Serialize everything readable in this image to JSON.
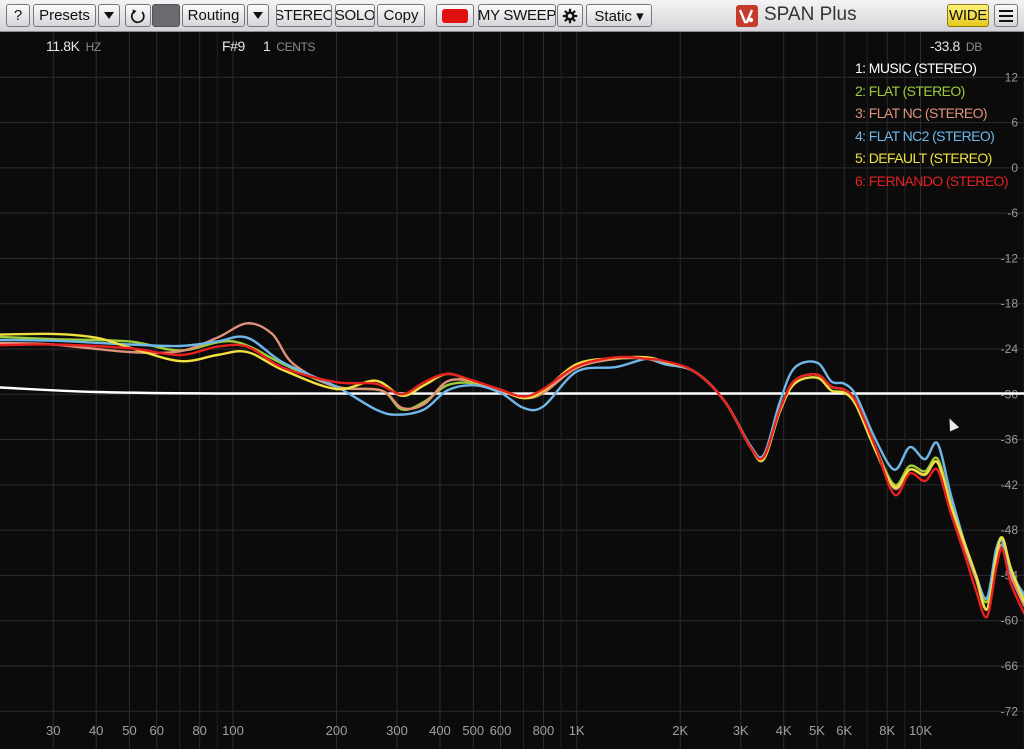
{
  "toolbar": {
    "help_label": "?",
    "presets_label": "Presets",
    "routing_label": "Routing",
    "stereo_label": "STEREO",
    "solo_label": "SOLO",
    "copy_label": "Copy",
    "sweep_label": "MY SWEEP",
    "mode_label": "Static ▾",
    "wide_label": "WIDE",
    "app_title": "SPAN Plus",
    "record_color": "#e01010"
  },
  "readout": {
    "freq_value": "11.8K",
    "freq_unit": "HZ",
    "note": "F#9",
    "cents_value": "1",
    "cents_unit": "CENTS",
    "level_value": "-33.8",
    "level_unit": "DB"
  },
  "chart_data": {
    "type": "line",
    "title": "",
    "xlabel": "",
    "ylabel": "",
    "x_scale": "log",
    "xlim": [
      21,
      20000
    ],
    "ylim": [
      -77,
      18
    ],
    "x_ticks": [
      {
        "value": 30,
        "label": "30"
      },
      {
        "value": 40,
        "label": "40"
      },
      {
        "value": 50,
        "label": "50"
      },
      {
        "value": 60,
        "label": "60"
      },
      {
        "value": 80,
        "label": "80"
      },
      {
        "value": 100,
        "label": "100"
      },
      {
        "value": 200,
        "label": "200"
      },
      {
        "value": 300,
        "label": "300"
      },
      {
        "value": 400,
        "label": "400"
      },
      {
        "value": 500,
        "label": "500"
      },
      {
        "value": 600,
        "label": "600"
      },
      {
        "value": 800,
        "label": "800"
      },
      {
        "value": 1000,
        "label": "1K"
      },
      {
        "value": 2000,
        "label": "2K"
      },
      {
        "value": 3000,
        "label": "3K"
      },
      {
        "value": 4000,
        "label": "4K"
      },
      {
        "value": 5000,
        "label": "5K"
      },
      {
        "value": 6000,
        "label": "6K"
      },
      {
        "value": 8000,
        "label": "8K"
      },
      {
        "value": 10000,
        "label": "10K"
      }
    ],
    "x_minor": [
      70,
      90,
      700,
      900,
      7000,
      9000,
      20000
    ],
    "y_ticks": [
      12,
      6,
      0,
      -6,
      -12,
      -18,
      -24,
      -30,
      -36,
      -42,
      -48,
      -54,
      -60,
      -66,
      -72
    ],
    "grid": true,
    "legend_position": "top-right",
    "series": [
      {
        "name": "1: MUSIC (STEREO)",
        "color": "#ffffff",
        "points": [
          [
            21,
            -29.1
          ],
          [
            40,
            -29.7
          ],
          [
            100,
            -29.9
          ],
          [
            1000,
            -29.9
          ],
          [
            5000,
            -29.9
          ],
          [
            10000,
            -29.9
          ],
          [
            20000,
            -29.9
          ]
        ]
      },
      {
        "name": "2: FLAT (STEREO)",
        "color": "#9ccc3a",
        "points": [
          [
            21,
            -22.4
          ],
          [
            30,
            -22.7
          ],
          [
            50,
            -23.0
          ],
          [
            70,
            -24.2
          ],
          [
            100,
            -23.0
          ],
          [
            140,
            -26.0
          ],
          [
            200,
            -29.0
          ],
          [
            270,
            -29.5
          ],
          [
            310,
            -32.0
          ],
          [
            360,
            -31.0
          ],
          [
            420,
            -28.8
          ],
          [
            500,
            -28.5
          ],
          [
            600,
            -29.5
          ],
          [
            700,
            -30.5
          ],
          [
            800,
            -29.8
          ],
          [
            1000,
            -26.5
          ],
          [
            1300,
            -25.3
          ],
          [
            1600,
            -25.3
          ],
          [
            1800,
            -26.0
          ],
          [
            2200,
            -27.0
          ],
          [
            2700,
            -31.0
          ],
          [
            3200,
            -37.0
          ],
          [
            3500,
            -38.3
          ],
          [
            3900,
            -32.0
          ],
          [
            4300,
            -28.2
          ],
          [
            5000,
            -27.4
          ],
          [
            5500,
            -29.0
          ],
          [
            6000,
            -29.4
          ],
          [
            6500,
            -31.0
          ],
          [
            7400,
            -37.0
          ],
          [
            8400,
            -42.0
          ],
          [
            9300,
            -39.5
          ],
          [
            10300,
            -40.2
          ],
          [
            11200,
            -38.5
          ],
          [
            12200,
            -44.0
          ],
          [
            13500,
            -50.0
          ],
          [
            14500,
            -54.0
          ],
          [
            15600,
            -57.5
          ],
          [
            16600,
            -51.0
          ],
          [
            17300,
            -49.0
          ],
          [
            18300,
            -53.0
          ],
          [
            20000,
            -57.0
          ]
        ]
      },
      {
        "name": "3: FLAT NC (STEREO)",
        "color": "#e0917a",
        "points": [
          [
            21,
            -23.2
          ],
          [
            30,
            -23.4
          ],
          [
            50,
            -24.4
          ],
          [
            70,
            -24.3
          ],
          [
            90,
            -22.5
          ],
          [
            110,
            -20.6
          ],
          [
            130,
            -22.0
          ],
          [
            150,
            -26.0
          ],
          [
            200,
            -29.0
          ],
          [
            270,
            -29.5
          ],
          [
            310,
            -31.8
          ],
          [
            360,
            -31.3
          ],
          [
            420,
            -28.3
          ],
          [
            500,
            -28.3
          ],
          [
            600,
            -29.5
          ],
          [
            700,
            -30.5
          ],
          [
            800,
            -29.8
          ],
          [
            1000,
            -26.5
          ],
          [
            1300,
            -25.3
          ],
          [
            1600,
            -25.3
          ],
          [
            1800,
            -26.0
          ],
          [
            2200,
            -27.0
          ],
          [
            2700,
            -31.0
          ],
          [
            3200,
            -37.0
          ],
          [
            3500,
            -38.3
          ],
          [
            3900,
            -32.0
          ],
          [
            4300,
            -28.2
          ],
          [
            5000,
            -27.4
          ],
          [
            5500,
            -29.0
          ],
          [
            6000,
            -29.4
          ],
          [
            6500,
            -31.0
          ],
          [
            7400,
            -37.0
          ],
          [
            8400,
            -42.5
          ],
          [
            9300,
            -40.0
          ],
          [
            10300,
            -40.7
          ],
          [
            11200,
            -39.0
          ],
          [
            12200,
            -44.5
          ],
          [
            13500,
            -50.5
          ],
          [
            14500,
            -54.5
          ],
          [
            15600,
            -58.5
          ],
          [
            16600,
            -52.0
          ],
          [
            17300,
            -50.0
          ],
          [
            18300,
            -54.0
          ],
          [
            20000,
            -58.0
          ]
        ]
      },
      {
        "name": "4: FLAT NC2 (STEREO)",
        "color": "#6fb7e8",
        "points": [
          [
            21,
            -22.8
          ],
          [
            30,
            -22.9
          ],
          [
            50,
            -23.4
          ],
          [
            70,
            -23.6
          ],
          [
            90,
            -23.0
          ],
          [
            110,
            -22.5
          ],
          [
            140,
            -25.8
          ],
          [
            200,
            -29.0
          ],
          [
            260,
            -32.0
          ],
          [
            300,
            -32.7
          ],
          [
            360,
            -32.0
          ],
          [
            420,
            -29.5
          ],
          [
            500,
            -28.8
          ],
          [
            600,
            -29.8
          ],
          [
            700,
            -31.8
          ],
          [
            800,
            -31.6
          ],
          [
            1000,
            -27.0
          ],
          [
            1300,
            -26.4
          ],
          [
            1600,
            -25.3
          ],
          [
            1800,
            -26.0
          ],
          [
            2200,
            -27.0
          ],
          [
            2700,
            -31.0
          ],
          [
            3200,
            -36.8
          ],
          [
            3500,
            -38.0
          ],
          [
            3900,
            -31.0
          ],
          [
            4300,
            -26.5
          ],
          [
            5000,
            -25.8
          ],
          [
            5500,
            -28.3
          ],
          [
            6000,
            -28.6
          ],
          [
            6500,
            -30.2
          ],
          [
            7400,
            -36.0
          ],
          [
            8400,
            -40.0
          ],
          [
            9300,
            -37.0
          ],
          [
            10300,
            -38.6
          ],
          [
            11200,
            -36.5
          ],
          [
            12200,
            -43.0
          ],
          [
            13500,
            -50.0
          ],
          [
            14500,
            -54.0
          ],
          [
            15600,
            -57.0
          ],
          [
            16600,
            -50.5
          ],
          [
            17300,
            -49.5
          ],
          [
            18300,
            -53.5
          ],
          [
            20000,
            -56.5
          ]
        ]
      },
      {
        "name": "5: DEFAULT (STEREO)",
        "color": "#f0e040",
        "points": [
          [
            21,
            -22.1
          ],
          [
            30,
            -22.0
          ],
          [
            40,
            -22.5
          ],
          [
            50,
            -23.8
          ],
          [
            70,
            -25.6
          ],
          [
            90,
            -24.8
          ],
          [
            110,
            -24.4
          ],
          [
            140,
            -26.8
          ],
          [
            200,
            -29.3
          ],
          [
            260,
            -28.2
          ],
          [
            310,
            -30.2
          ],
          [
            360,
            -28.8
          ],
          [
            420,
            -27.3
          ],
          [
            500,
            -28.3
          ],
          [
            600,
            -29.4
          ],
          [
            700,
            -30.5
          ],
          [
            800,
            -29.5
          ],
          [
            1000,
            -26.0
          ],
          [
            1300,
            -25.2
          ],
          [
            1600,
            -25.1
          ],
          [
            1800,
            -25.7
          ],
          [
            2200,
            -27.0
          ],
          [
            2700,
            -31.0
          ],
          [
            3200,
            -37.0
          ],
          [
            3500,
            -38.6
          ],
          [
            3900,
            -32.3
          ],
          [
            4300,
            -28.6
          ],
          [
            5000,
            -27.8
          ],
          [
            5500,
            -29.5
          ],
          [
            6000,
            -29.8
          ],
          [
            6500,
            -31.5
          ],
          [
            7400,
            -37.5
          ],
          [
            8400,
            -42.3
          ],
          [
            9300,
            -40.0
          ],
          [
            10300,
            -40.6
          ],
          [
            11200,
            -39.0
          ],
          [
            12200,
            -44.5
          ],
          [
            13500,
            -50.0
          ],
          [
            14500,
            -54.0
          ],
          [
            15600,
            -58.5
          ],
          [
            16600,
            -51.5
          ],
          [
            17300,
            -49.0
          ],
          [
            18300,
            -53.0
          ],
          [
            20000,
            -57.5
          ]
        ]
      },
      {
        "name": "6: FERNANDO (STEREO)",
        "color": "#e82020",
        "points": [
          [
            21,
            -23.5
          ],
          [
            30,
            -23.4
          ],
          [
            50,
            -23.9
          ],
          [
            70,
            -24.8
          ],
          [
            90,
            -23.7
          ],
          [
            110,
            -23.7
          ],
          [
            140,
            -26.5
          ],
          [
            200,
            -28.4
          ],
          [
            260,
            -28.6
          ],
          [
            310,
            -30.0
          ],
          [
            360,
            -28.4
          ],
          [
            420,
            -27.3
          ],
          [
            500,
            -28.2
          ],
          [
            600,
            -29.4
          ],
          [
            700,
            -30.3
          ],
          [
            800,
            -29.3
          ],
          [
            1000,
            -26.3
          ],
          [
            1300,
            -25.1
          ],
          [
            1600,
            -25.3
          ],
          [
            1800,
            -25.6
          ],
          [
            2200,
            -27.0
          ],
          [
            2700,
            -31.0
          ],
          [
            3200,
            -37.0
          ],
          [
            3500,
            -38.3
          ],
          [
            3900,
            -32.0
          ],
          [
            4300,
            -28.2
          ],
          [
            5000,
            -27.4
          ],
          [
            5500,
            -29.0
          ],
          [
            6000,
            -29.4
          ],
          [
            6500,
            -31.0
          ],
          [
            7400,
            -37.0
          ],
          [
            8400,
            -43.3
          ],
          [
            9300,
            -40.5
          ],
          [
            10300,
            -41.5
          ],
          [
            11200,
            -40.0
          ],
          [
            12200,
            -45.5
          ],
          [
            13500,
            -51.5
          ],
          [
            14500,
            -56.0
          ],
          [
            15600,
            -59.5
          ],
          [
            16600,
            -53.0
          ],
          [
            17300,
            -50.5
          ],
          [
            18300,
            -55.0
          ],
          [
            20000,
            -59.0
          ]
        ]
      }
    ]
  }
}
